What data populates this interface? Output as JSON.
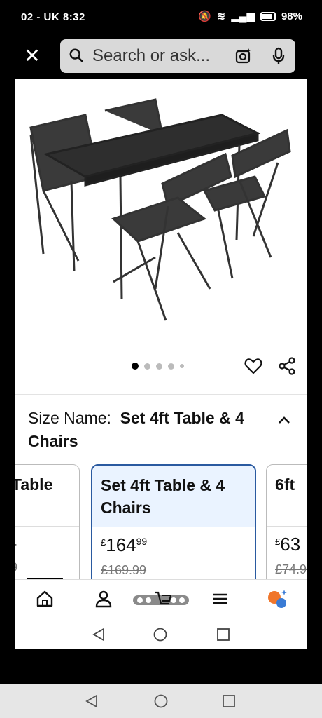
{
  "status": {
    "time": "02 - UK 8:32",
    "battery": "98%"
  },
  "search": {
    "placeholder": "Search or ask..."
  },
  "product": {
    "image_count": 5,
    "active_image": 1
  },
  "size": {
    "label": "Size Name:",
    "value": "Set 4ft Table & 4 Chairs"
  },
  "options": [
    {
      "name": "Table",
      "price": "",
      "old_price": "",
      "partial_price": "4",
      "partial_old": "9"
    },
    {
      "name": "Set 4ft Table & 4 Chairs",
      "currency": "£",
      "price_whole": "164",
      "price_frac": "99",
      "old_price": "£169.99"
    },
    {
      "name": "6ft",
      "currency": "£",
      "price_whole": "63",
      "old_price": "£74.9"
    }
  ],
  "icons": {
    "close": "close-icon",
    "search": "search-icon",
    "camera": "camera-icon",
    "mic": "mic-icon",
    "heart": "heart-icon",
    "share": "share-icon",
    "home": "home-icon",
    "account": "account-icon",
    "cart": "cart-icon",
    "menu": "menu-icon",
    "assistant": "assistant-icon"
  }
}
